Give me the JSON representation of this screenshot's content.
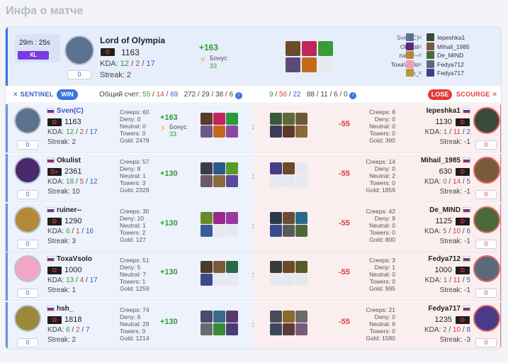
{
  "page_title": "Инфа о матче",
  "header": {
    "duration": "29m : 25s",
    "size_badge": "XL",
    "player_name": "Lord of Olympia",
    "rank": "D",
    "mmr": "1163",
    "kda_label": "KDA:",
    "k": "12",
    "d": "2",
    "a": "17",
    "sep": "/",
    "streak": "Streak: 2",
    "level_pill": "0",
    "delta": "+163",
    "bonus_label": "Бонус",
    "bonus_value": "33",
    "sentinel_roster": [
      "Sven(C)",
      "Okulist",
      "ruiner--",
      "ToxaVsolo",
      "hsh_"
    ],
    "scourge_roster": [
      "Iepeshka1",
      "Mihail_1985",
      "De_MIND",
      "Fedya712",
      "Fedya717"
    ]
  },
  "stats_bar": {
    "sentinel_label": "SENTINEL",
    "win_badge": "WIN",
    "total_label": "Общий счет:",
    "s_k": "55",
    "s_d": "14",
    "s_a": "69",
    "s_creeps": "272",
    "s_deny": "29",
    "s_neut": "38",
    "s_tow": "6",
    "sc_k": "9",
    "sc_d": "56",
    "sc_a": "22",
    "sc_creeps": "88",
    "sc_deny": "11",
    "sc_neut": "6",
    "sc_tow": "0",
    "lose_badge": "LOSE",
    "scourge_label": "SCOURGE"
  },
  "sentinel": [
    {
      "name": "Sven(C)",
      "rank": "D",
      "mmr": "1163",
      "k": "12",
      "d": "2",
      "a": "17",
      "streak": "Streak: 2",
      "pill": "0",
      "creeps": "Creeps: 60",
      "deny": "Deny: 0",
      "neutral": "Neutral: 0",
      "towers": "Towers: 0",
      "gold": "Gold: 2479",
      "delta": "+163",
      "bonus_label": "Бонус",
      "bonus": "33"
    },
    {
      "name": "Okulist",
      "rank": "D+",
      "mmr": "2361",
      "k": "18",
      "d": "5",
      "a": "12",
      "streak": "Streak: 10",
      "pill": "0",
      "creeps": "Creeps: 57",
      "deny": "Deny: 8",
      "neutral": "Neutral: 1",
      "towers": "Towers: 3",
      "gold": "Gold: 2329",
      "delta": "+130"
    },
    {
      "name": "ruiner--",
      "rank": "D",
      "mmr": "1290",
      "k": "6",
      "d": "1",
      "a": "16",
      "streak": "Streak: 3",
      "pill": "0",
      "creeps": "Creeps: 30",
      "deny": "Deny: 10",
      "neutral": "Neutral: 1",
      "towers": "Towers: 2",
      "gold": "Gold: 127",
      "delta": "+130"
    },
    {
      "name": "ToxaVsolo",
      "rank": "D",
      "mmr": "1000",
      "k": "13",
      "d": "4",
      "a": "17",
      "streak": "Streak: 1",
      "pill": "0",
      "creeps": "Creeps: 51",
      "deny": "Deny: 5",
      "neutral": "Neutral: 7",
      "towers": "Towers: 1",
      "gold": "Gold: 1259",
      "delta": "+130"
    },
    {
      "name": "hsh_",
      "rank": "D",
      "mmr": "1818",
      "k": "6",
      "d": "2",
      "a": "7",
      "streak": "Streak: 2",
      "pill": "0",
      "creeps": "Creeps: 74",
      "deny": "Deny: 6",
      "neutral": "Neutral: 29",
      "towers": "Towers: 0",
      "gold": "Gold: 1214",
      "delta": "+130"
    }
  ],
  "scourge": [
    {
      "name": "Iepeshka1",
      "rank": "D",
      "mmr": "1130",
      "k": "1",
      "d": "11",
      "a": "2",
      "streak": "Streak: -1",
      "pill": "0",
      "creeps": "Creeps: 8",
      "deny": "Deny: 0",
      "neutral": "Neutral: 0",
      "towers": "Towers: 0",
      "gold": "Gold: 390",
      "delta": "-55"
    },
    {
      "name": "Mihail_1985",
      "rank": "D",
      "mmr": "630",
      "k": "0",
      "d": "14",
      "a": "5",
      "streak": "Streak: -1",
      "pill": "0",
      "creeps": "Creeps: 14",
      "deny": "Deny: 0",
      "neutral": "Neutral: 2",
      "towers": "Towers: 0",
      "gold": "Gold: 1859",
      "delta": "-55"
    },
    {
      "name": "De_MIND",
      "rank": "D",
      "mmr": "1125",
      "k": "5",
      "d": "10",
      "a": "6",
      "streak": "Streak: -1",
      "pill": "0",
      "creeps": "Creeps: 42",
      "deny": "Deny: 9",
      "neutral": "Neutral: 0",
      "towers": "Towers: 0",
      "gold": "Gold: 800",
      "delta": "-55"
    },
    {
      "name": "Fedya712",
      "rank": "D",
      "mmr": "1000",
      "k": "1",
      "d": "11",
      "a": "5",
      "streak": "Streak: -1",
      "pill": "0",
      "creeps": "Creeps: 3",
      "deny": "Deny: 1",
      "neutral": "Neutral: 0",
      "towers": "Towers: 0",
      "gold": "Gold: 995",
      "delta": "-55"
    },
    {
      "name": "Fedya717",
      "rank": "D",
      "mmr": "1235",
      "k": "2",
      "d": "10",
      "a": "8",
      "streak": "Streak: -3",
      "pill": "0",
      "creeps": "Creeps: 21",
      "deny": "Deny: 0",
      "neutral": "Neutral: 6",
      "towers": "Towers: 0",
      "gold": "Gold: 1580",
      "delta": "-55"
    }
  ],
  "labels": {
    "kda": "KDA:",
    "sep": "/"
  }
}
